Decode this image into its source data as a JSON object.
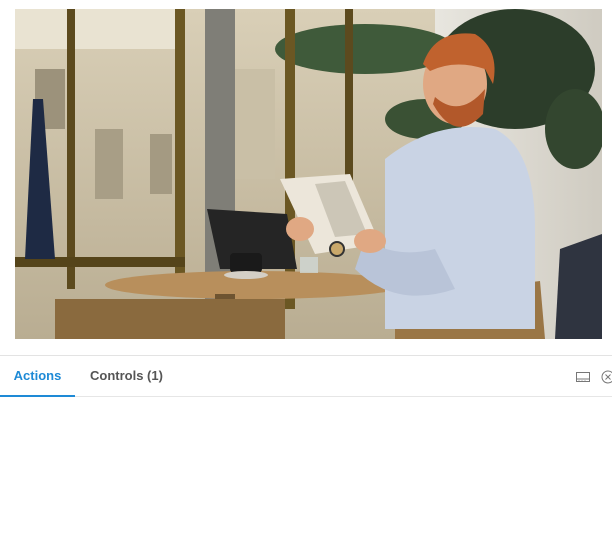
{
  "preview": {
    "image_subject": "man with red beard reading a newspaper at a cafe table beside large windows, laptop and coffee cup on table"
  },
  "tabs": [
    {
      "label": "Actions",
      "active": true
    },
    {
      "label": "Controls (1)",
      "active": false
    }
  ],
  "toolbar": {
    "icons": [
      "panel-dock-icon",
      "close-circle-icon"
    ]
  },
  "colors": {
    "accent": "#1e8ad6",
    "tab_text": "#555555"
  }
}
